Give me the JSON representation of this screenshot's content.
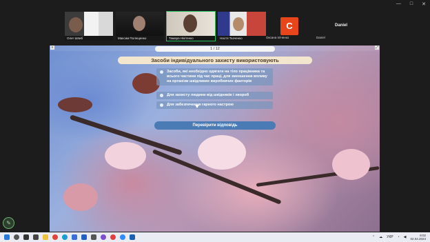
{
  "window": {
    "controls": [
      "—",
      "□",
      "✕"
    ]
  },
  "participants": [
    {
      "name": "Олег Шпиб"
    },
    {
      "name": "Максим Полещенко"
    },
    {
      "name": "Тамара Нікітенко"
    },
    {
      "name": "Настя Ткаченко"
    },
    {
      "name": "Оксана Іліченко",
      "initial": "C"
    },
    {
      "name": "Daniel",
      "display": "Daniel"
    }
  ],
  "quiz": {
    "pager": "1 / 12",
    "title": "Засоби індивідуального захисту використовують",
    "options": [
      {
        "label": "Засоби, які необхідно одягати на тіло працівника та всього частини під час праці, для зменшення впливу на організм шкідливих виробничих факторів"
      },
      {
        "label": "Для захисту людини від шкідників і хвороб"
      },
      {
        "label": "Для забезпечення гарного настрою"
      }
    ],
    "check_button": "Перевірити відповідь"
  },
  "taskbar": {
    "lang": "УКР",
    "time": "8:02",
    "date": "02.04.2024"
  },
  "colors": {
    "active_speaker": "#20c05c",
    "accent_c": "#e8461a",
    "button": "#4b7bb4"
  }
}
